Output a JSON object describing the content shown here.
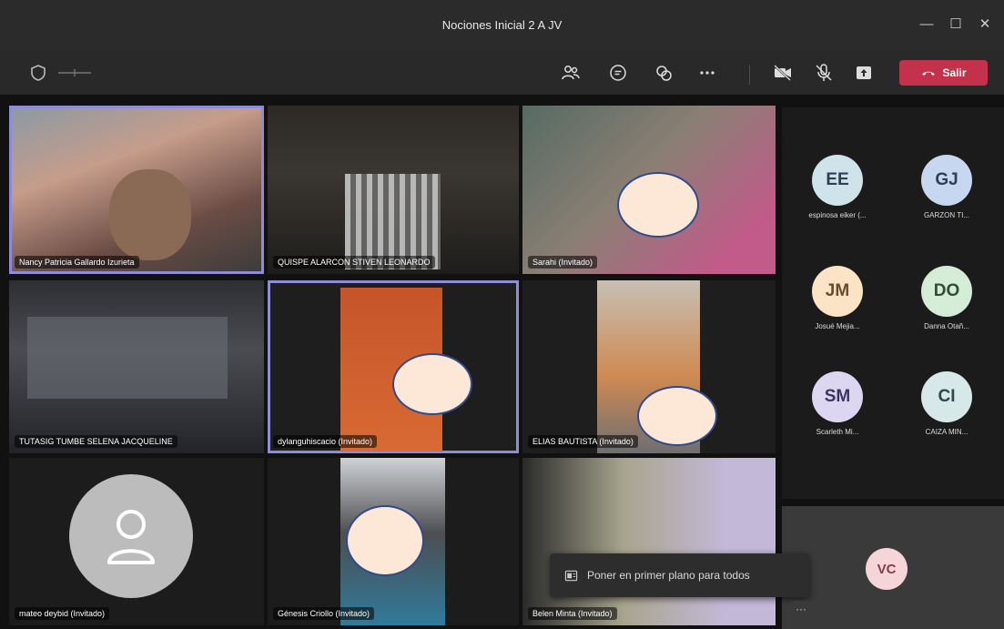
{
  "window": {
    "title": "Nociones Inicial 2 A JV",
    "minimize": "—",
    "maximize": "☐",
    "close": "✕"
  },
  "toolbar": {
    "leave_label": "Salir",
    "icons": [
      "shield-icon",
      "participants-icon",
      "chat-icon",
      "reactions-icon",
      "more-icon",
      "camera-off-icon",
      "mic-off-icon",
      "share-icon"
    ],
    "leave_color": "#c4314b"
  },
  "tiles": [
    {
      "name": "Nancy Patricia Gallardo Izurieta",
      "active": true
    },
    {
      "name": "QUISPE ALARCON STIVEN LEONARDO"
    },
    {
      "name": "Sarahi (Invitado)"
    },
    {
      "name": "TUTASIG TUMBE SELENA JACQUELINE"
    },
    {
      "name": "dylanguhiscacio (Invitado)",
      "active": true
    },
    {
      "name": "ELIAS BAUTISTA (Invitado)"
    },
    {
      "name": "mateo deybid (Invitado)"
    },
    {
      "name": "Génesis Criollo (Invitado)"
    },
    {
      "name": "Belen Minta (Invitado)"
    }
  ],
  "roster": [
    {
      "initials": "EE",
      "name": "espinosa eiker (...",
      "color": "#cfe3ea"
    },
    {
      "initials": "GJ",
      "name": "GARZON TI...",
      "color": "#c7d7f0"
    },
    {
      "initials": "JM",
      "name": "Josué Mejia...",
      "color": "#fbe3c6"
    },
    {
      "initials": "DO",
      "name": "Danna Otañ...",
      "color": "#d5ecd7"
    },
    {
      "initials": "SM",
      "name": "Scarleth Mi...",
      "color": "#dcd6f0"
    },
    {
      "initials": "CI",
      "name": "CAIZA MIN...",
      "color": "#d7e8e8"
    }
  ],
  "self_view": {
    "initials": "VC",
    "color": "#f6d5d9"
  },
  "popover": {
    "label": "Poner en primer plano para todos"
  },
  "more_button": "···"
}
